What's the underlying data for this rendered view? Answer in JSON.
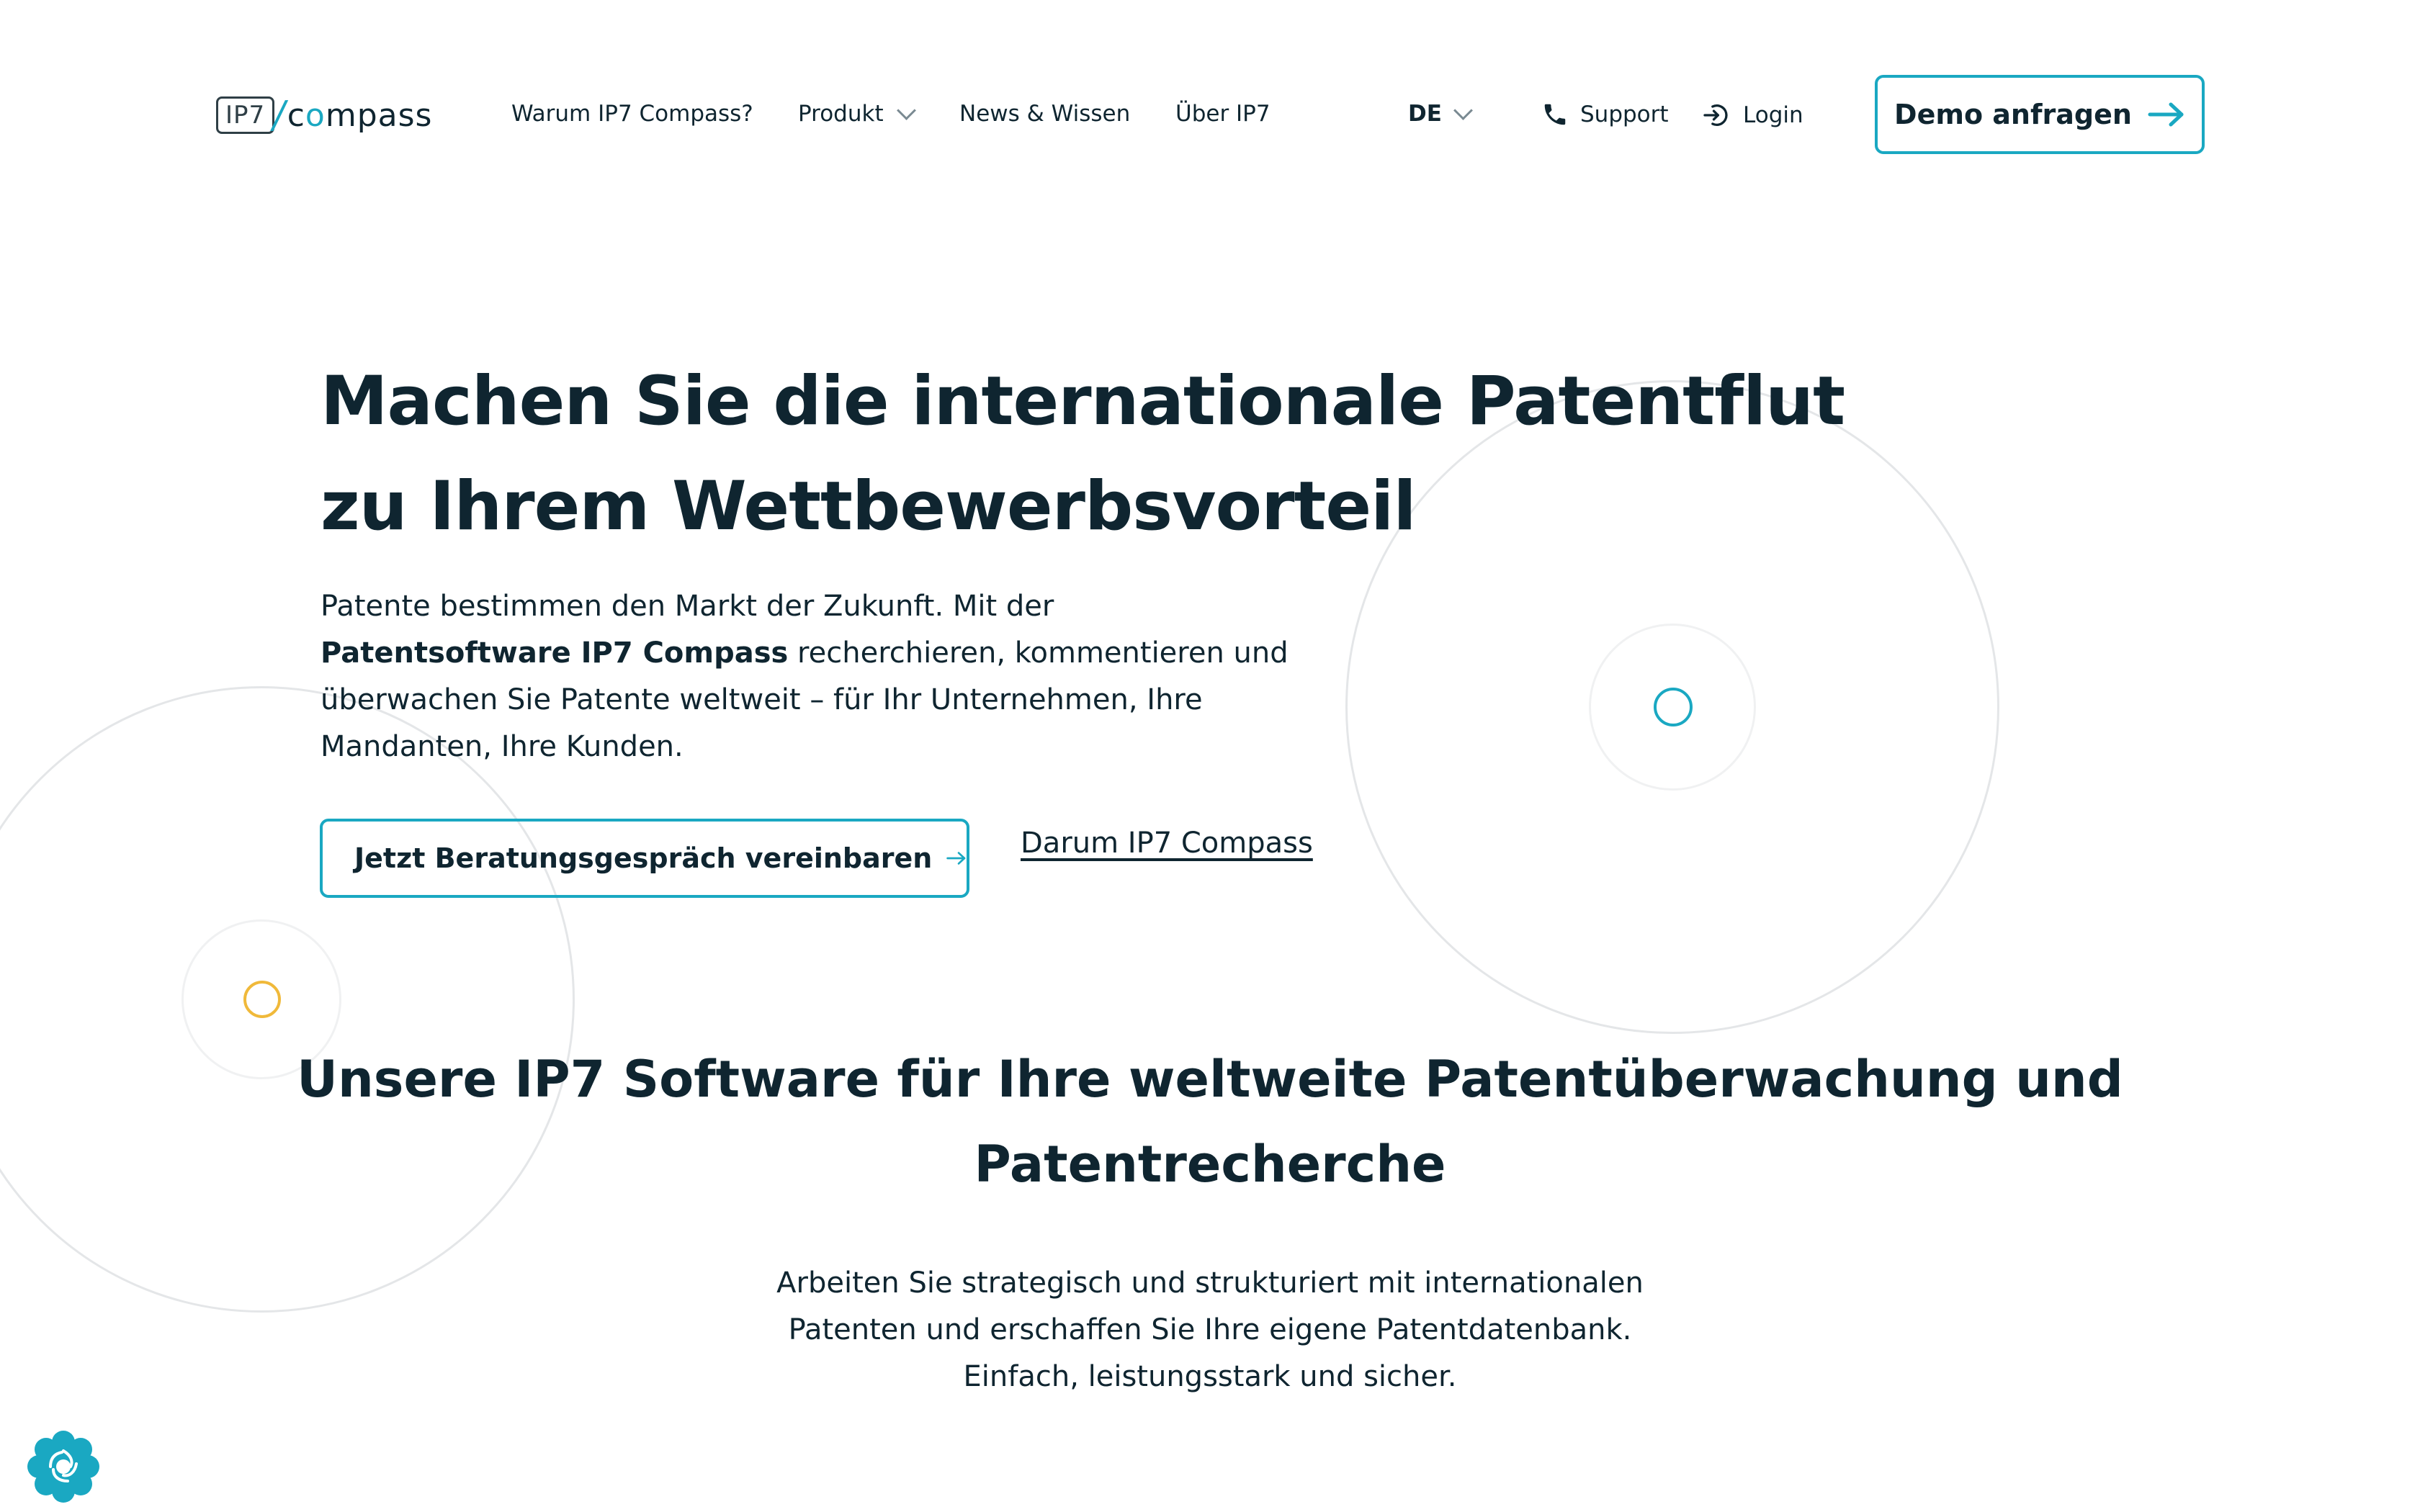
{
  "header": {
    "logo": {
      "box_text": "IP7",
      "text_pre": "c",
      "text_accent": "o",
      "text_post": "mpass"
    },
    "nav": [
      {
        "label": "Warum IP7 Compass?",
        "has_dropdown": false
      },
      {
        "label": "Produkt",
        "has_dropdown": true
      },
      {
        "label": "News & Wissen",
        "has_dropdown": false
      },
      {
        "label": "Über IP7",
        "has_dropdown": false
      }
    ],
    "language": "DE",
    "support_label": "Support",
    "login_label": "Login",
    "demo_label": "Demo anfragen"
  },
  "hero": {
    "title_line1": "Machen Sie die internationale Patentflut",
    "title_line2": "zu Ihrem Wettbewerbsvorteil",
    "text_line1": "Patente bestimmen den Markt der Zukunft. Mit der",
    "text_bold": "Patentsoftware IP7 Compass",
    "text_line2_rest": " recherchieren, kommentieren und",
    "text_line3": "überwachen Sie Patente weltweit – für Ihr Unternehmen, Ihre",
    "text_line4": "Mandanten, Ihre Kunden.",
    "cta_label": "Jetzt Beratungsgespräch vereinbaren",
    "link_label": "Darum IP7 Compass"
  },
  "section": {
    "title_line1": "Unsere IP7 Software für Ihre weltweite Patentüberwachung und",
    "title_line2": "Patentrecherche",
    "text_line1": "Arbeiten Sie strategisch und strukturiert mit internationalen",
    "text_line2": "Patenten und erschaffen Sie Ihre eigene Patentdatenbank.",
    "text_line3": "Einfach, leistungsstark und sicher."
  },
  "colors": {
    "text": "#0f2530",
    "accent_teal": "#1aa8c2",
    "accent_yellow": "#f0b93a",
    "decor_line": "#e4e6e8"
  },
  "icons": [
    "chevron-down-icon",
    "phone-icon",
    "login-icon",
    "arrow-right-icon",
    "cookie-settings-icon"
  ]
}
